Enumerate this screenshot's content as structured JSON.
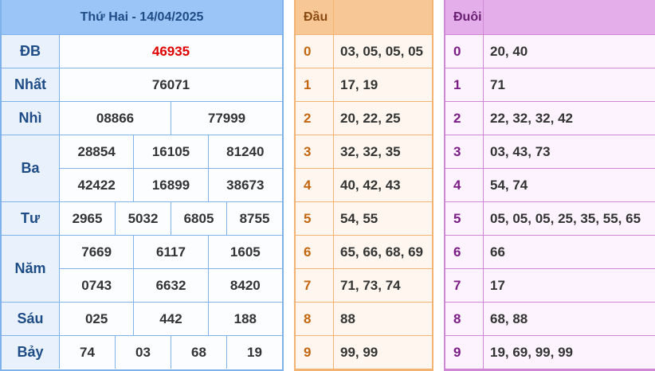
{
  "results": {
    "title": "Thứ Hai - 14/04/2025",
    "prizes": [
      {
        "label": "ĐB",
        "lines": [
          [
            "46935"
          ]
        ],
        "special": true
      },
      {
        "label": "Nhất",
        "lines": [
          [
            "76071"
          ]
        ]
      },
      {
        "label": "Nhì",
        "lines": [
          [
            "08866",
            "77999"
          ]
        ]
      },
      {
        "label": "Ba",
        "lines": [
          [
            "28854",
            "16105",
            "81240"
          ],
          [
            "42422",
            "16899",
            "38673"
          ]
        ]
      },
      {
        "label": "Tư",
        "lines": [
          [
            "2965",
            "5032",
            "6805",
            "8755"
          ]
        ]
      },
      {
        "label": "Năm",
        "lines": [
          [
            "7669",
            "6117",
            "1605"
          ],
          [
            "0743",
            "6632",
            "8420"
          ]
        ]
      },
      {
        "label": "Sáu",
        "lines": [
          [
            "025",
            "442",
            "188"
          ]
        ]
      },
      {
        "label": "Bảy",
        "lines": [
          [
            "74",
            "03",
            "68",
            "19"
          ]
        ]
      }
    ]
  },
  "dau": {
    "header": "Đầu",
    "rows": [
      {
        "key": "0",
        "value": "03, 05, 05, 05"
      },
      {
        "key": "1",
        "value": "17, 19"
      },
      {
        "key": "2",
        "value": "20, 22, 25"
      },
      {
        "key": "3",
        "value": "32, 32, 35"
      },
      {
        "key": "4",
        "value": "40, 42, 43"
      },
      {
        "key": "5",
        "value": "54, 55"
      },
      {
        "key": "6",
        "value": "65, 66, 68, 69"
      },
      {
        "key": "7",
        "value": "71, 73, 74"
      },
      {
        "key": "8",
        "value": "88"
      },
      {
        "key": "9",
        "value": "99, 99"
      }
    ]
  },
  "duoi": {
    "header": "Đuôi",
    "rows": [
      {
        "key": "0",
        "value": "20, 40"
      },
      {
        "key": "1",
        "value": "71"
      },
      {
        "key": "2",
        "value": "22, 32, 32, 42"
      },
      {
        "key": "3",
        "value": "03, 43, 73"
      },
      {
        "key": "4",
        "value": "54, 74"
      },
      {
        "key": "5",
        "value": "05, 05, 05, 25, 35, 55, 65"
      },
      {
        "key": "6",
        "value": "66"
      },
      {
        "key": "7",
        "value": "17"
      },
      {
        "key": "8",
        "value": "68, 88"
      },
      {
        "key": "9",
        "value": "19, 69, 99, 99"
      }
    ]
  },
  "colors": {
    "special_number": "#e00000",
    "results_header": "#9cc5f7",
    "dau_header": "#f8c796",
    "duoi_header": "#e3aeea"
  }
}
